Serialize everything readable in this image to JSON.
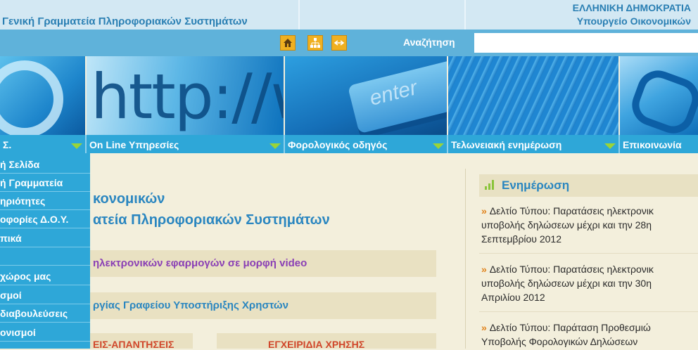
{
  "header": {
    "ministry_title": "Γενική Γραμματεία Πληροφοριακών Συστημάτων",
    "gov_line1": "ΕΛΛΗΝΙΚΗ ΔΗΜΟΚΡΑΤΙΑ",
    "gov_line2": "Υπουργείο Οικονομικών"
  },
  "toolbar": {
    "icons": [
      "home-icon",
      "sitemap-icon",
      "arrows-icon"
    ],
    "search_label": "Αναζήτηση",
    "search_value": "",
    "search_placeholder": ""
  },
  "banner": {
    "http_text": "http://www",
    "key_text": "enter"
  },
  "nav": {
    "items": [
      {
        "label": "Σ."
      },
      {
        "label": "On Line Υπηρεσίες"
      },
      {
        "label": "Φορολογικός οδηγός"
      },
      {
        "label": "Τελωνειακή ενημέρωση"
      },
      {
        "label": "Επικοινωνία"
      }
    ]
  },
  "leftmenu": {
    "items": [
      {
        "label": "ή Σελίδα"
      },
      {
        "label": "ή Γραμματεία"
      },
      {
        "label": "ηριότητες"
      },
      {
        "label": "οφορίες Δ.Ο.Υ."
      },
      {
        "label": "πικά"
      },
      {
        "label": ""
      },
      {
        "label": "χώρος μας"
      },
      {
        "label": "σμοί"
      },
      {
        "label": "διαβουλεύσεις"
      },
      {
        "label": "ονισμοί"
      }
    ]
  },
  "main": {
    "title_line1": "κονομικών",
    "title_line2": "ατεία Πληροφοριακών Συστημάτων",
    "box1": "ηλεκτρονικών εφαρμογών σε μορφή video",
    "box2": "ργίας Γραφείου Υποστήριξης Χρηστών",
    "faq_button": "ΕΙΣ-ΑΠΑΝΤΗΣΕΙΣ",
    "manuals_button": "ΕΓΧΕΙΡΙΔΙΑ ΧΡΗΣΗΣ"
  },
  "news": {
    "heading": "Ενημέρωση",
    "items": [
      {
        "line1": "Δελτίο Τύπου: Παρατάσεις ηλεκτρονικ",
        "line2": "υποβολής δηλώσεων μέχρι και την 28η",
        "line3": "Σεπτεμβρίου 2012"
      },
      {
        "line1": "Δελτίο Τύπου: Παρατάσεις ηλεκτρονικ",
        "line2": "υποβολής δηλώσεων μέχρι και την 30η",
        "line3": "Απριλίου 2012"
      },
      {
        "line1": "Δελτίο Τύπου: Παράταση Προθεσμιώ",
        "line2": "Υποβολής Φορολογικών Δηλώσεων",
        "line3": ""
      }
    ]
  },
  "colors": {
    "accent_blue": "#2ea7d8",
    "title_blue": "#2a86c0",
    "button_orange": "#f0b020",
    "nav_arrow_green": "#9ad438",
    "background_beige": "#f3efdc"
  }
}
